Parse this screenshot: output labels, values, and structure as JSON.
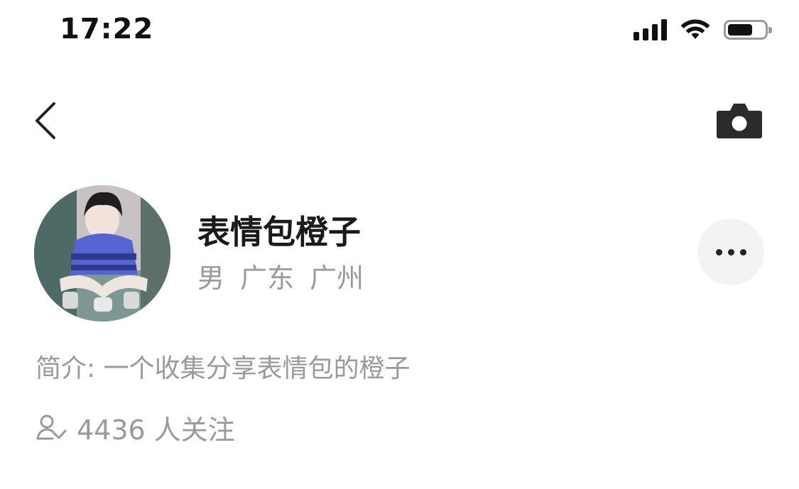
{
  "status_bar": {
    "time": "17:22"
  },
  "profile": {
    "name": "表情包橙子",
    "location": "男 广东 广州",
    "bio": "简介: 一个收集分享表情包的橙子",
    "followers": "4436 人关注"
  },
  "icons": {
    "back": "chevron-left-icon",
    "camera": "camera-icon",
    "more": "more-horizontal-icon",
    "followers": "user-check-icon",
    "signal": "signal-icon",
    "wifi": "wifi-icon",
    "battery": "battery-icon"
  }
}
